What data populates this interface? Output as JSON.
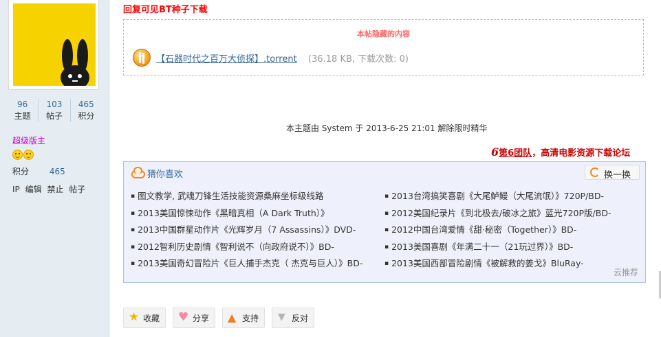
{
  "profile": {
    "stats": [
      {
        "num": "96",
        "label": "主题"
      },
      {
        "num": "103",
        "label": "帖子"
      },
      {
        "num": "465",
        "label": "积分"
      }
    ],
    "rank": "超级版主",
    "credits_label": "积分",
    "credits_value": "465",
    "admin_links": [
      "IP",
      "编辑",
      "禁止",
      "帖子"
    ]
  },
  "post": {
    "reply_tip": "回复可见BT种子下载",
    "hidden_title": "本帖隐藏的内容",
    "torrent_name": "【石器时代之百万大侦探】.torrent",
    "torrent_meta": "(36.18 KB, 下载次数: 0)",
    "system_note": "本主题由 System 于 2013-6-25 21:01 解除限时精华",
    "team_six": "6",
    "team_name": "第6团队",
    "team_slogan": "，高清电影资源下载论坛"
  },
  "guess": {
    "title": "猜你喜欢",
    "swap_label": "换一换",
    "left_items": [
      "图文教学, 武魂刀锋生活技能资源桑麻坐标级线路",
      "2013美国惊悚动作《黑暗真相（A Dark Truth）》",
      "2013中国群星动作片《光辉岁月（7 Assassins）》DVD-",
      "2012智利历史剧情《智利说不（向政府说不）》BD-",
      "2013美国奇幻冒险片《巨人捕手杰克（ 杰克与巨人）》BD-"
    ],
    "right_items": [
      "2013台湾搞笑喜剧《大尾鲈鳗（大尾流氓）》720P/BD-",
      "2012美国纪录片《到北极去/破冰之旅》蓝光720P版/BD-",
      "2012中国台湾爱情《甜·秘密（Together）》BD-",
      "2013美国喜剧《年满二十一（21玩过界）》BD-",
      "2013美国西部冒险剧情《被解救的姜戈》BluRay-"
    ],
    "footer": "云推荐"
  },
  "actions": {
    "favorite": "收藏",
    "share": "分享",
    "support": "支持",
    "oppose": "反对"
  },
  "colors": {
    "sidebar_bg": "#e5edf2",
    "link": "#336699",
    "tip_red": "#ff0000",
    "hidden_border": "#ff9a9a",
    "guess_bg": "#eef1fb",
    "guess_border": "#a8c3de",
    "avatar_yellow": "#f6d200"
  }
}
